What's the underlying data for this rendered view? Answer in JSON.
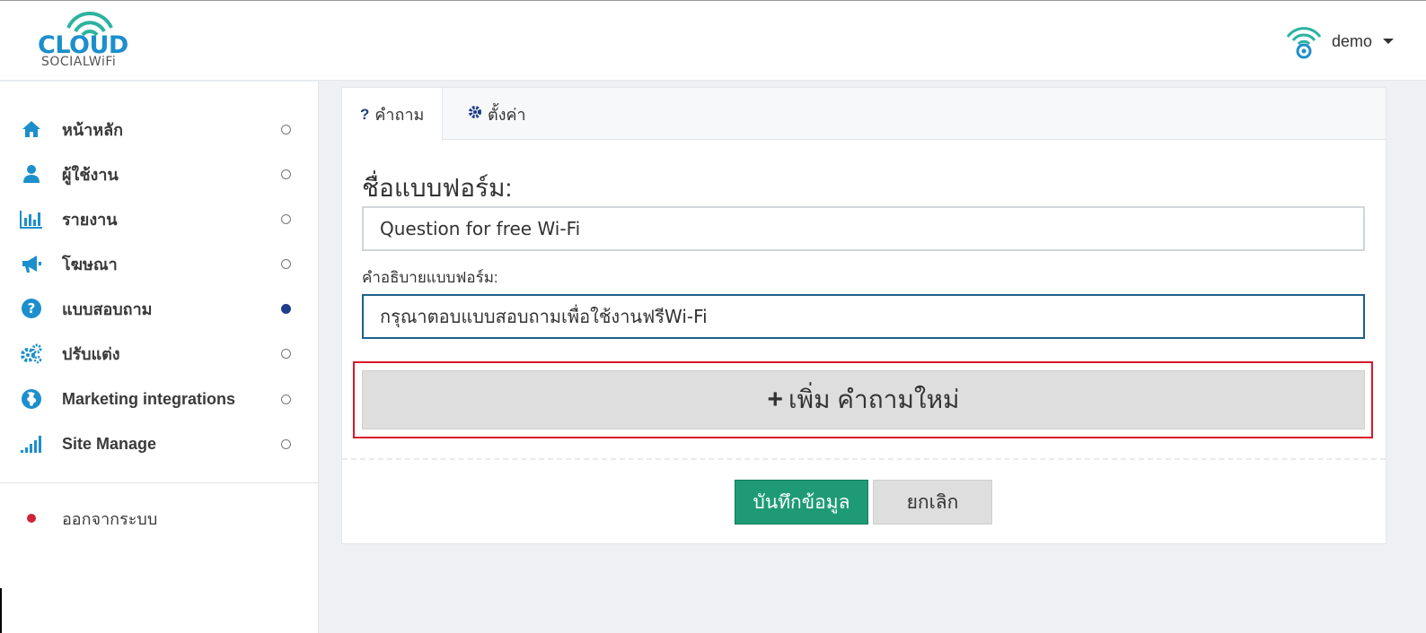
{
  "header": {
    "logo": {
      "word": "CLOUD",
      "sub": "SOCIALWiFi"
    },
    "user_name": "demo"
  },
  "sidebar": {
    "items": [
      {
        "label": "หน้าหลัก",
        "icon": "home-icon",
        "active": false
      },
      {
        "label": "ผู้ใช้งาน",
        "icon": "user-icon",
        "active": false
      },
      {
        "label": "รายงาน",
        "icon": "bar-chart-icon",
        "active": false
      },
      {
        "label": "โฆษณา",
        "icon": "megaphone-icon",
        "active": false
      },
      {
        "label": "แบบสอบถาม",
        "icon": "question-circle-icon",
        "active": true
      },
      {
        "label": "ปรับแต่ง",
        "icon": "cogs-icon",
        "active": false
      },
      {
        "label": "Marketing integrations",
        "icon": "globe-icon",
        "active": false
      },
      {
        "label": "Site Manage",
        "icon": "signal-icon",
        "active": false
      }
    ],
    "logout_label": "ออกจากระบบ"
  },
  "tabs": [
    {
      "label": "คำถาม",
      "icon": "question-icon",
      "active": true
    },
    {
      "label": "ตั้งค่า",
      "icon": "gear-icon",
      "active": false
    }
  ],
  "form": {
    "title_label": "ชื่อแบบฟอร์ม:",
    "title_value": "Question for free Wi-Fi",
    "desc_label": "คำอธิบายแบบฟอร์ม:",
    "desc_value": "กรุณาตอบแบบสอบถามเพื่อใช้งานฟรีWi-Fi",
    "add_question_label": "เพิ่ม คำถามใหม่",
    "save_label": "บันทึกข้อมูล",
    "cancel_label": "ยกเลิก"
  },
  "colors": {
    "brand_blue": "#1c8fcc",
    "active_dot": "#1f3d8a",
    "save_green": "#1e9b76",
    "highlight_red": "#d9182a",
    "logout_red": "#d0243a"
  }
}
